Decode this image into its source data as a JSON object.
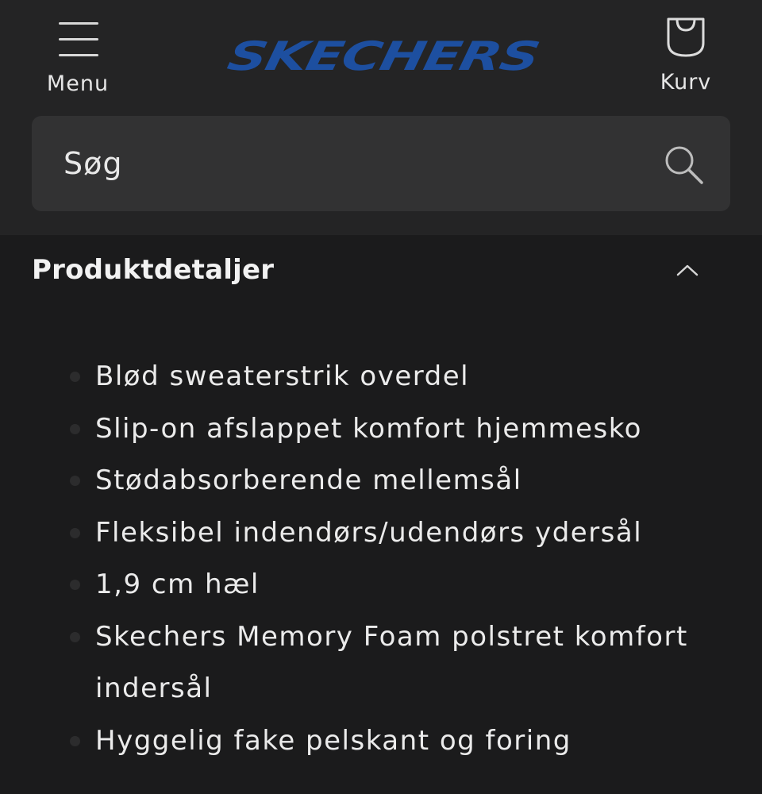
{
  "header": {
    "menu_label": "Menu",
    "logo_text": "SKECHERS",
    "cart_label": "Kurv",
    "brand_color": "#1d4fa0"
  },
  "search": {
    "placeholder": "Søg"
  },
  "product_details": {
    "title": "Produktdetaljer",
    "expanded": true,
    "features": [
      "Blød sweaterstrik overdel",
      "Slip-on afslappet komfort hjemmesko",
      "Stødabsorberende mellemsål",
      "Fleksibel indendørs/udendørs ydersål",
      "1,9 cm hæl",
      "Skechers Memory Foam polstret komfort indersål",
      "Hyggelig fake pelskant og foring"
    ]
  },
  "icons": [
    "menu-icon",
    "cart-icon",
    "search-icon",
    "chevron-up-icon"
  ]
}
